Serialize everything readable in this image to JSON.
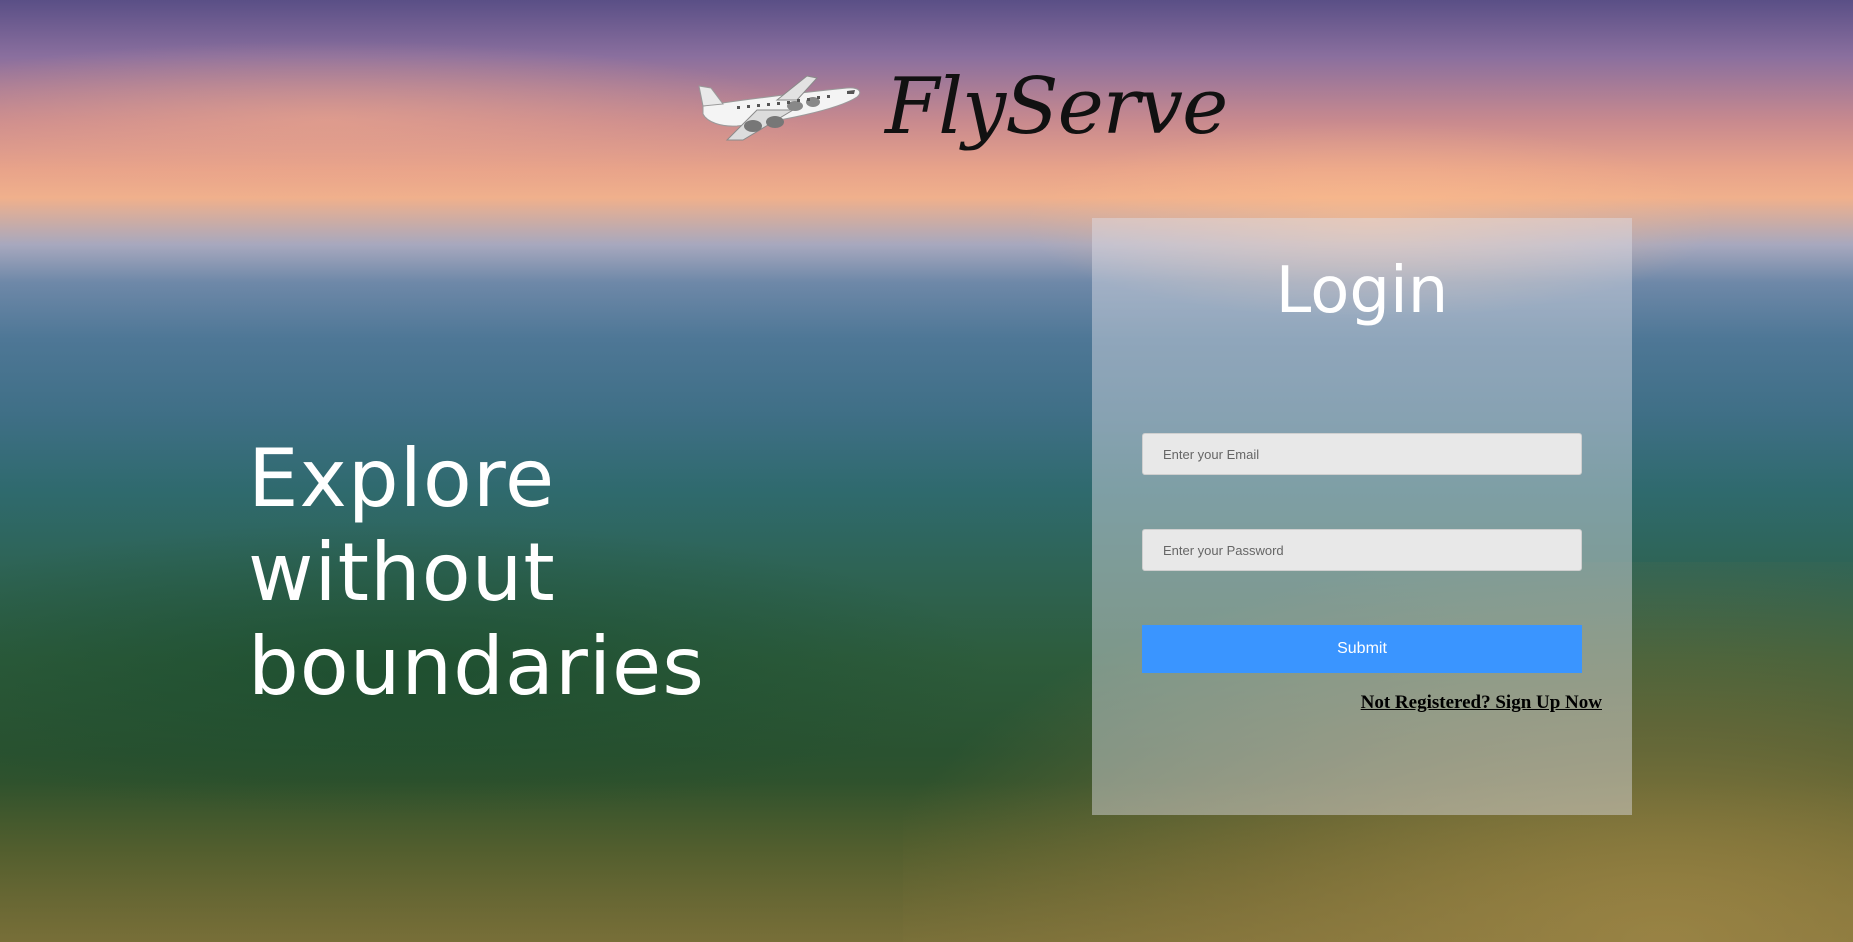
{
  "brand": {
    "name": "FlyServe",
    "logo_icon": "airplane-icon"
  },
  "hero": {
    "tagline": "Explore without boundaries"
  },
  "login": {
    "title": "Login",
    "email_placeholder": "Enter your Email",
    "email_value": "",
    "password_placeholder": "Enter your Password",
    "password_value": "",
    "submit_label": "Submit",
    "signup_link": "Not Registered? Sign Up Now"
  },
  "colors": {
    "submit_button": "#3a95ff",
    "panel_background": "rgba(225,225,232,0.45)",
    "tagline_text": "#ffffff",
    "brand_text": "#111111"
  }
}
